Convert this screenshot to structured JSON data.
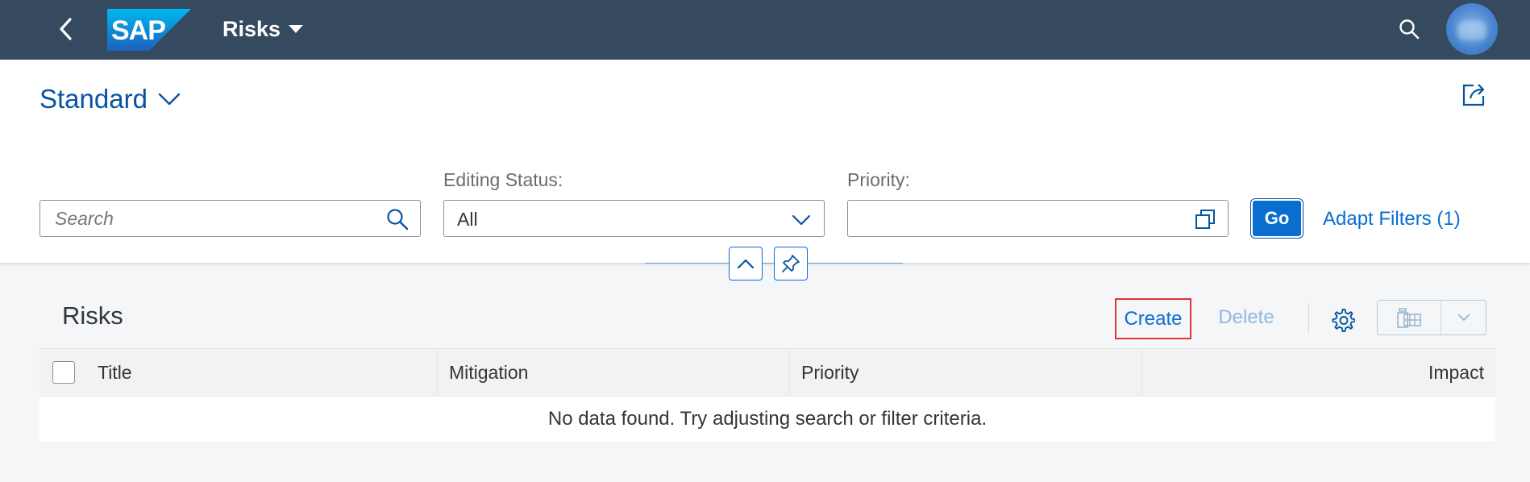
{
  "shell": {
    "logo_text": "SAP",
    "app_title": "Risks",
    "colors": {
      "shell_bg": "#354a5f",
      "logo_blue": "#0a8ed9"
    }
  },
  "header": {
    "variant_name": "Standard",
    "filters": {
      "search_placeholder": "Search",
      "editing_status_label": "Editing Status:",
      "editing_status_value": "All",
      "priority_label": "Priority:",
      "priority_value": ""
    },
    "go_label": "Go",
    "adapt_filters_label": "Adapt Filters (1)"
  },
  "table": {
    "title": "Risks",
    "toolbar": {
      "create_label": "Create",
      "delete_label": "Delete"
    },
    "columns": [
      "Title",
      "Mitigation",
      "Priority",
      "Impact"
    ],
    "no_data_text": "No data found. Try adjusting search or filter criteria."
  },
  "icons": [
    "back-icon",
    "search-icon",
    "share-icon",
    "chevron-down-icon",
    "value-help-icon",
    "collapse-icon",
    "pin-icon",
    "gear-icon",
    "export-icon"
  ],
  "colors": {
    "accent": "#0a6ed1",
    "highlight_box": "#e0303a"
  }
}
